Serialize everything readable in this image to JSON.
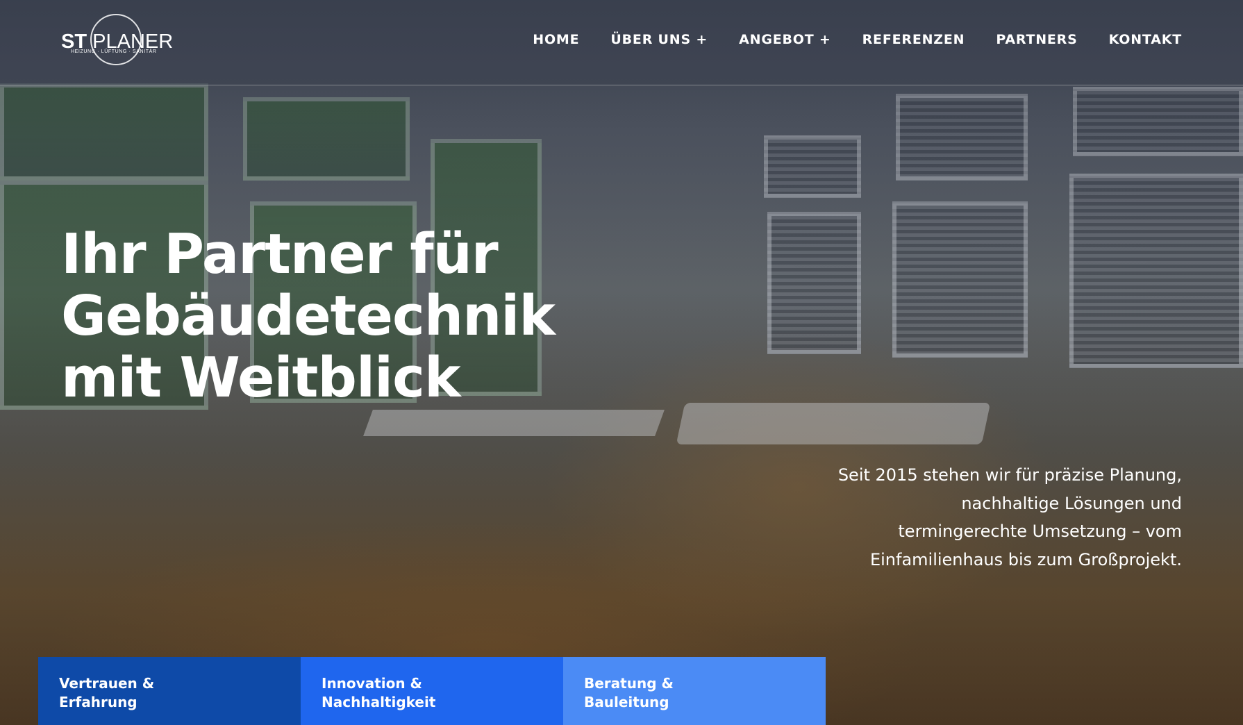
{
  "brand": {
    "logo_st": "ST",
    "logo_planer": "PLANER",
    "logo_tagline": "HEIZUNG · LÜFTUNG · SANITÄR"
  },
  "nav": {
    "items": [
      {
        "label": "HOME"
      },
      {
        "label": "ÜBER UNS +"
      },
      {
        "label": "ANGEBOT +"
      },
      {
        "label": "REFERENZEN"
      },
      {
        "label": "PARTNERS"
      },
      {
        "label": "KONTAKT"
      }
    ]
  },
  "hero": {
    "headline_lines": [
      "Ihr Partner für",
      "Gebäudetechnik",
      "mit Weitblick"
    ],
    "intro_lines": [
      "Seit 2015 stehen wir für präzise Planung,",
      "nachhaltige Lösungen und",
      "termingerechte Umsetzung – vom",
      "Einfamilienhaus bis zum Großprojekt."
    ]
  },
  "features": [
    {
      "lines": [
        "Vertrauen &",
        "Erfahrung"
      ],
      "color": "#0e4aa8"
    },
    {
      "lines": [
        "Innovation &",
        "Nachhaltigkeit"
      ],
      "color": "#1f66ee"
    },
    {
      "lines": [
        "Beratung &",
        "Bauleitung"
      ],
      "color": "#4b8bf5"
    }
  ],
  "colors": {
    "header_overlay": "#3c4250",
    "text": "#ffffff"
  }
}
